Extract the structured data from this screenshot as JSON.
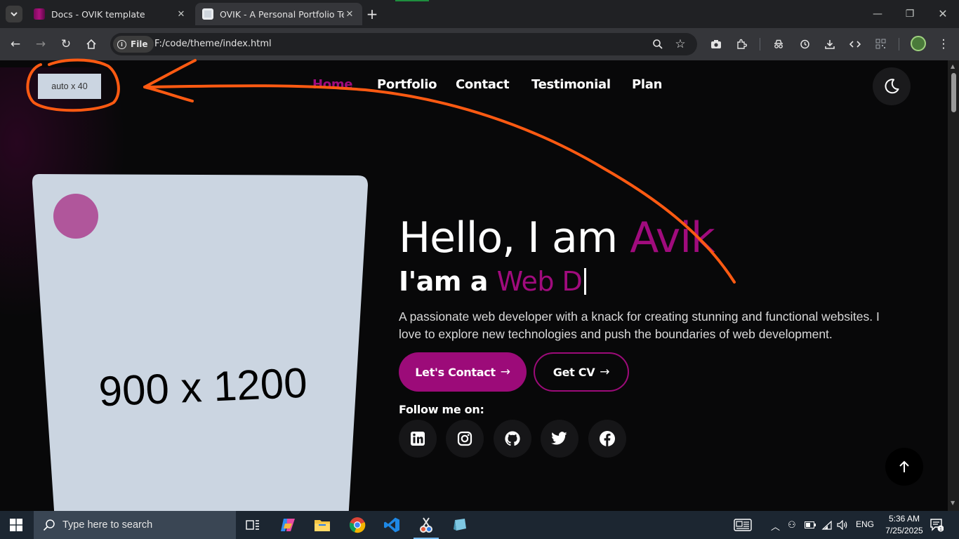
{
  "browser": {
    "tabs": [
      {
        "title": "Docs - OVIK template",
        "active": false
      },
      {
        "title": "OVIK - A Personal Portfolio Tem",
        "active": true
      }
    ],
    "address": {
      "scheme_chip": "File",
      "url": "F:/code/theme/index.html"
    },
    "icons": [
      "tab-search-icon",
      "back-icon",
      "forward-icon",
      "reload-icon",
      "home-icon",
      "zoom-icon",
      "bookmark-star-icon",
      "screenshot-icon",
      "extensions-icon",
      "incognito-icon",
      "history-icon",
      "download-icon",
      "devtools-icon",
      "qr-icon",
      "profile-avatar",
      "menu-kebab-icon",
      "minimize-icon",
      "maximize-icon",
      "close-window-icon"
    ]
  },
  "page": {
    "logo_placeholder": "auto x 40",
    "nav": [
      "Home",
      "Portfolio",
      "Contact",
      "Testimonial",
      "Plan"
    ],
    "portrait_placeholder": "900 x 1200",
    "hero": {
      "greeting": "Hello, I am ",
      "name": "Avik",
      "role_prefix": "I'am a ",
      "role_typed": "Web D",
      "description": "A passionate web developer with a knack for creating stunning and functional websites. I love to explore new technologies and push the boundaries of web development."
    },
    "buttons": {
      "contact": "Let's Contact",
      "cv": "Get CV"
    },
    "follow_label": "Follow me on:",
    "socials": [
      "linkedin",
      "instagram",
      "github",
      "twitter",
      "facebook"
    ],
    "colors": {
      "accent": "#a00b7d",
      "background": "#080809",
      "annotation": "#ff5a12"
    }
  },
  "taskbar": {
    "search_placeholder": "Type here to search",
    "language": "ENG",
    "time": "5:36 AM",
    "date": "7/25/2025",
    "notification_count": "1"
  }
}
